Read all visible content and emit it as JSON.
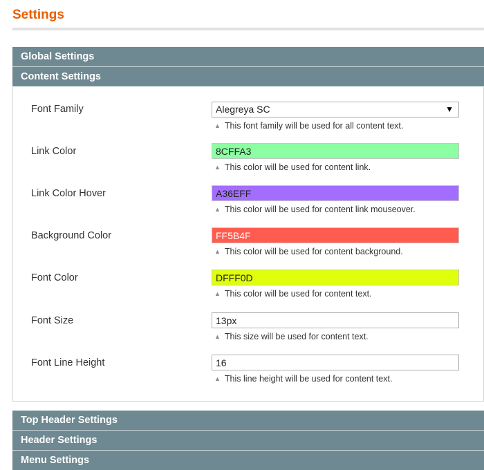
{
  "page": {
    "title": "Settings"
  },
  "sections_top": [
    {
      "label": "Global Settings"
    },
    {
      "label": "Content Settings"
    }
  ],
  "content_settings": {
    "rows": [
      {
        "label": "Font Family",
        "type": "select",
        "value": "Alegreya SC",
        "note": "This font family will be used for all content text."
      },
      {
        "label": "Link Color",
        "type": "color",
        "value": "8CFFA3",
        "bg": "#8cffa3",
        "text_color": "#222222",
        "note": "This color will be used for content link."
      },
      {
        "label": "Link Color Hover",
        "type": "color",
        "value": "A36EFF",
        "bg": "#a36eff",
        "text_color": "#222222",
        "note": "This color will be used for content link mouseover."
      },
      {
        "label": "Background Color",
        "type": "color",
        "value": "FF5B4F",
        "bg": "#ff5b4f",
        "text_color": "#ffffff",
        "note": "This color will be used for content background."
      },
      {
        "label": "Font Color",
        "type": "color",
        "value": "DFFF0D",
        "bg": "#dfff0d",
        "text_color": "#222222",
        "note": "This color will be used for content text."
      },
      {
        "label": "Font Size",
        "type": "text",
        "value": "13px",
        "note": "This size will be used for content text."
      },
      {
        "label": "Font Line Height",
        "type": "text",
        "value": "16",
        "note": "This line height will be used for content text."
      }
    ]
  },
  "sections_bottom": [
    {
      "label": "Top Header Settings"
    },
    {
      "label": "Header Settings"
    },
    {
      "label": "Menu Settings"
    }
  ],
  "icons": {
    "note_icon": "triangle-up-icon",
    "dropdown_icon": "chevron-down-icon"
  },
  "colors": {
    "accent_title": "#eb5e00",
    "section_bar": "#6f8992"
  }
}
